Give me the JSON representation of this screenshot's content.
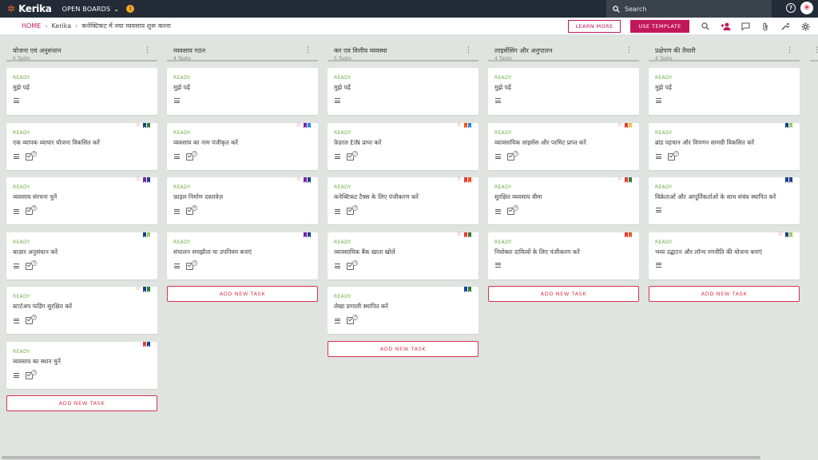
{
  "app": {
    "logo": "Kerika",
    "open_boards": "OPEN BOARDS",
    "search_placeholder": "Search"
  },
  "breadcrumb": {
    "home": "HOME",
    "org": "Kerika",
    "board": "कनेक्टिकट में नया व्यवसाय शुरू करना"
  },
  "toolbar": {
    "learn_more": "LEARN MORE",
    "use_template": "USE TEMPLATE"
  },
  "add_task_label": "ADD NEW TASK",
  "colors": {
    "accent": "#c2185b",
    "topbar": "#222b36",
    "ready": "#6cab43",
    "board_bg": "#dfe4e1"
  },
  "columns": [
    {
      "title": "योजना एवं अनुसंधान",
      "count": "6 Tasks",
      "cards": [
        {
          "status": "READY",
          "title": "मुझे पढ़ें",
          "checks": null,
          "star": false,
          "flags": []
        },
        {
          "status": "READY",
          "title": "एक व्यापक व्यापार योजना विकसित करें",
          "checks": "4",
          "star": true,
          "flags": [
            "#1a3f8f",
            "#2e7d32"
          ]
        },
        {
          "status": "READY",
          "title": "व्यवसाय संरचना चुनें",
          "checks": "4",
          "star": true,
          "flags": [
            "#7b1fa2",
            "#1a3f8f"
          ]
        },
        {
          "status": "READY",
          "title": "बाज़ार अनुसंधान करें",
          "checks": "3",
          "star": false,
          "flags": [
            "#1a3f8f",
            "#9ccc65"
          ]
        },
        {
          "status": "READY",
          "title": "स्टार्टअप फंडिंग सुरक्षित करें",
          "checks": "4",
          "star": true,
          "flags": [
            "#1a3f8f",
            "#2e7d32"
          ]
        },
        {
          "status": "READY",
          "title": "व्यवसाय का स्थान चुनें",
          "checks": "3",
          "star": false,
          "flags": [
            "#e53935",
            "#1a3f8f"
          ]
        }
      ]
    },
    {
      "title": "व्यवसाय गठन",
      "count": "4 Tasks",
      "cards": [
        {
          "status": "READY",
          "title": "मुझे पढ़ें",
          "checks": null,
          "star": false,
          "flags": []
        },
        {
          "status": "READY",
          "title": "व्यवसाय का नाम पंजीकृत करें",
          "checks": "3",
          "star": true,
          "flags": [
            "#7b1fa2",
            "#1e88e5"
          ]
        },
        {
          "status": "READY",
          "title": "फ़ाइल निर्माण दस्तावेज़",
          "checks": "4",
          "star": true,
          "flags": [
            "#7b1fa2",
            "#1a3f8f"
          ]
        },
        {
          "status": "READY",
          "title": "संचालन समझौता या उपनियम बनाएं",
          "checks": "3",
          "star": false,
          "flags": [
            "#7b1fa2",
            "#1a3f8f"
          ]
        }
      ]
    },
    {
      "title": "कर एवं वित्तीय व्यवस्था",
      "count": "5 Tasks",
      "cards": [
        {
          "status": "READY",
          "title": "मुझे पढ़ें",
          "checks": null,
          "star": false,
          "flags": []
        },
        {
          "status": "READY",
          "title": "फ़ेडरल EIN प्राप्त करें",
          "checks": "3",
          "star": true,
          "flags": [
            "#f4511e",
            "#1e88e5"
          ]
        },
        {
          "status": "READY",
          "title": "कनेक्टिकट टैक्स के लिए पंजीकरण करें",
          "checks": "3",
          "star": true,
          "flags": [
            "#e53935",
            "#f4511e"
          ]
        },
        {
          "status": "READY",
          "title": "व्यावसायिक बैंक खाता खोलें",
          "checks": "3",
          "star": true,
          "flags": [
            "#e53935",
            "#2e7d32"
          ]
        },
        {
          "status": "READY",
          "title": "लेखा प्रणाली स्थापित करें",
          "checks": "3",
          "star": false,
          "flags": [
            "#1a3f8f",
            "#2e7d32"
          ]
        }
      ]
    },
    {
      "title": "लाइसेंसिंग और अनुपालन",
      "count": "4 Tasks",
      "cards": [
        {
          "status": "READY",
          "title": "मुझे पढ़ें",
          "checks": null,
          "star": false,
          "flags": []
        },
        {
          "status": "READY",
          "title": "व्यावसायिक लाइसेंस और परमिट प्राप्त करें",
          "checks": "3",
          "star": true,
          "flags": [
            "#e53935",
            "#ffb74d"
          ]
        },
        {
          "status": "READY",
          "title": "सुरक्षित व्यवसाय बीमा",
          "checks": "3",
          "star": true,
          "flags": [
            "#e53935",
            "#2e7d32"
          ]
        },
        {
          "status": "READY",
          "title": "नियोक्ता दायित्वों के लिए पंजीकरण करें",
          "checks": null,
          "star": false,
          "flags": [
            "#e53935",
            "#f4511e"
          ]
        }
      ]
    },
    {
      "title": "प्रक्षेपण की तैयारी",
      "count": "4 Tasks",
      "cards": [
        {
          "status": "READY",
          "title": "मुझे पढ़ें",
          "checks": null,
          "star": false,
          "flags": []
        },
        {
          "status": "READY",
          "title": "ब्रांड पहचान और विपणन सामग्री विकसित करें",
          "checks": "3",
          "star": false,
          "flags": [
            "#1a3f8f",
            "#9ccc65"
          ]
        },
        {
          "status": "READY",
          "title": "विक्रेताओं और आपूर्तिकर्ताओं के साथ संबंध स्थापित करें",
          "checks": null,
          "star": false,
          "flags": [
            "#1a3f8f",
            "#1a3f8f"
          ]
        },
        {
          "status": "READY",
          "title": "भव्य उद्घाटन और लॉन्च रणनीति की योजना बनाएं",
          "checks": null,
          "star": true,
          "flags": [
            "#1a3f8f",
            "#9ccc65"
          ]
        }
      ]
    }
  ]
}
